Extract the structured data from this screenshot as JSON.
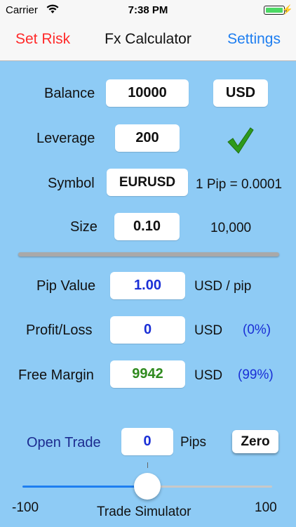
{
  "status_bar": {
    "carrier": "Carrier",
    "time": "7:38 PM"
  },
  "nav": {
    "left": "Set Risk",
    "title": "Fx Calculator",
    "right": "Settings"
  },
  "account": {
    "balance_label": "Balance",
    "balance_value": "10000",
    "currency": "USD",
    "leverage_label": "Leverage",
    "leverage_value": "200",
    "symbol_label": "Symbol",
    "symbol_value": "EURUSD",
    "pip_info": "1 Pip = 0.0001",
    "size_label": "Size",
    "size_value": "0.10",
    "units": "10,000"
  },
  "results": {
    "pip_value_label": "Pip Value",
    "pip_value": "1.00",
    "pip_unit": "USD / pip",
    "pl_label": "Profit/Loss",
    "pl_value": "0",
    "pl_unit": "USD",
    "pl_pct": "(0%)",
    "margin_label": "Free Margin",
    "margin_value": "9942",
    "margin_unit": "USD",
    "margin_pct": "(99%)"
  },
  "trade": {
    "open_label": "Open Trade",
    "pips_value": "0",
    "pips_label": "Pips",
    "zero_button": "Zero",
    "sim_min": "-100",
    "sim_max": "100",
    "sim_label": "Trade Simulator",
    "sim_value": 0
  },
  "colors": {
    "background": "#8ecbf5",
    "accent": "#1e7ef0",
    "danger": "#ff2a2a",
    "pip_value": "#1a2fd6",
    "margin": "#2f8a1e"
  },
  "icons": [
    "wifi-icon",
    "battery-icon",
    "charging-icon",
    "checkmark-icon"
  ]
}
